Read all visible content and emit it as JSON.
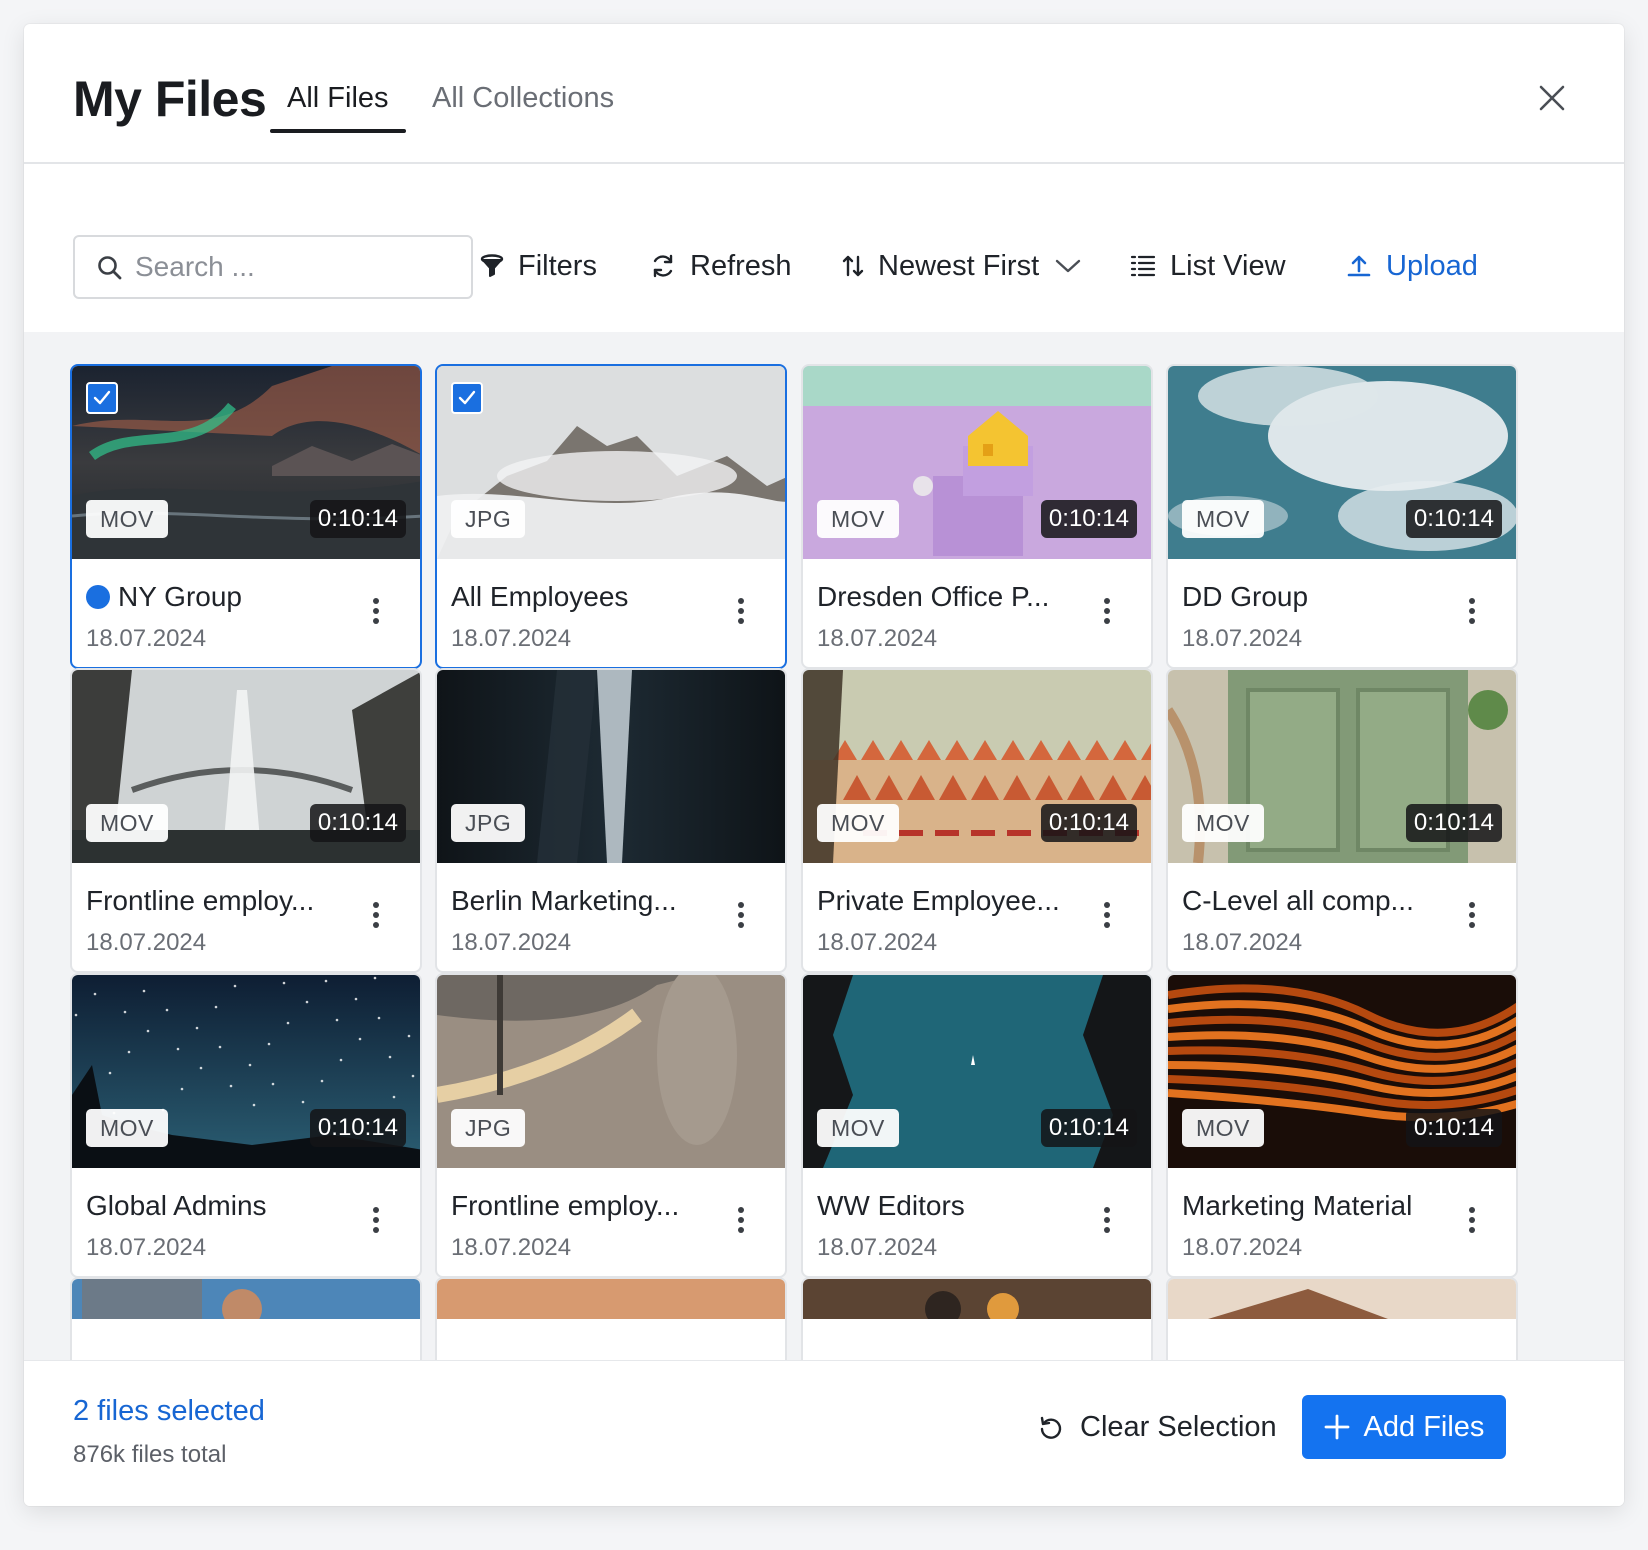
{
  "header": {
    "title": "My Files",
    "tabs": [
      {
        "label": "All Files",
        "active": true
      },
      {
        "label": "All Collections",
        "active": false
      }
    ]
  },
  "toolbar": {
    "search_placeholder": "Search ...",
    "filters_label": "Filters",
    "refresh_label": "Refresh",
    "sort_label": "Newest First",
    "view_label": "List View",
    "upload_label": "Upload"
  },
  "files": [
    {
      "name": "NY Group",
      "date": "18.07.2024",
      "type": "MOV",
      "duration": "0:10:14",
      "selected": true,
      "online_dot": true
    },
    {
      "name": "All Employees",
      "date": "18.07.2024",
      "type": "JPG",
      "duration": "",
      "selected": true,
      "online_dot": false
    },
    {
      "name": "Dresden Office P...",
      "date": "18.07.2024",
      "type": "MOV",
      "duration": "0:10:14",
      "selected": false,
      "online_dot": false
    },
    {
      "name": "DD Group",
      "date": "18.07.2024",
      "type": "MOV",
      "duration": "0:10:14",
      "selected": false,
      "online_dot": false
    },
    {
      "name": "Frontline employ...",
      "date": "18.07.2024",
      "type": "MOV",
      "duration": "0:10:14",
      "selected": false,
      "online_dot": false
    },
    {
      "name": "Berlin Marketing...",
      "date": "18.07.2024",
      "type": "JPG",
      "duration": "",
      "selected": false,
      "online_dot": false
    },
    {
      "name": "Private Employee...",
      "date": "18.07.2024",
      "type": "MOV",
      "duration": "0:10:14",
      "selected": false,
      "online_dot": false
    },
    {
      "name": "C-Level all comp...",
      "date": "18.07.2024",
      "type": "MOV",
      "duration": "0:10:14",
      "selected": false,
      "online_dot": false
    },
    {
      "name": "Global Admins",
      "date": "18.07.2024",
      "type": "MOV",
      "duration": "0:10:14",
      "selected": false,
      "online_dot": false
    },
    {
      "name": "Frontline employ...",
      "date": "18.07.2024",
      "type": "JPG",
      "duration": "",
      "selected": false,
      "online_dot": false
    },
    {
      "name": "WW Editors",
      "date": "18.07.2024",
      "type": "MOV",
      "duration": "0:10:14",
      "selected": false,
      "online_dot": false
    },
    {
      "name": "Marketing Material",
      "date": "18.07.2024",
      "type": "MOV",
      "duration": "0:10:14",
      "selected": false,
      "online_dot": false
    }
  ],
  "footer": {
    "selected_text": "2 files selected",
    "total_text": "876k files total",
    "clear_label": "Clear Selection",
    "add_label": "Add Files"
  },
  "colors": {
    "accent": "#1473f0",
    "link": "#1766d3",
    "selected_border": "#1a6fe0"
  }
}
